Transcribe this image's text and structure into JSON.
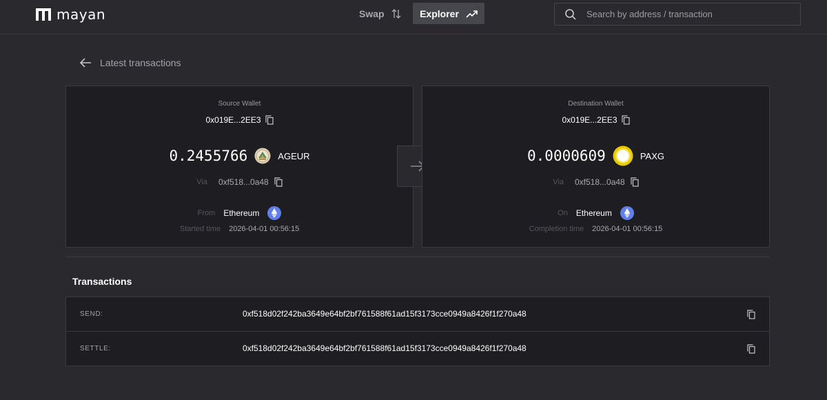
{
  "header": {
    "logo_text": "mayan",
    "nav": {
      "swap_label": "Swap",
      "explorer_label": "Explorer"
    },
    "search": {
      "placeholder": "Search by address / transaction",
      "value": ""
    }
  },
  "back_link": {
    "label": "Latest transactions"
  },
  "source": {
    "title": "Source Wallet",
    "wallet": "0x019E...2EE3",
    "amount": "0.2455766",
    "token": "AGEUR",
    "via_label": "Via",
    "via_value": "0xf518...0a48",
    "chain_label": "From",
    "chain": "Ethereum",
    "time_label": "Started time",
    "time": "2026-04-01 00:56:15"
  },
  "destination": {
    "title": "Destination Wallet",
    "wallet": "0x019E...2EE3",
    "amount": "0.0000609",
    "token": "PAXG",
    "via_label": "Via",
    "via_value": "0xf518...0a48",
    "chain_label": "On",
    "chain": "Ethereum",
    "time_label": "Completion time",
    "time": "2026-04-01 00:56:15"
  },
  "transactions": {
    "heading": "Transactions",
    "rows": [
      {
        "label": "SEND:",
        "hash": "0xf518d02f242ba3649e64bf2bf761588f61ad15f3173cce0949a8426f1f270a48"
      },
      {
        "label": "SETTLE:",
        "hash": "0xf518d02f242ba3649e64bf2bf761588f61ad15f3173cce0949a8426f1f270a48"
      }
    ]
  },
  "icons": {
    "logo": "mayan-logo-icon",
    "swap": "swap-arrows-icon",
    "explorer": "trend-line-icon",
    "search": "search-icon",
    "back": "arrow-left-icon",
    "copy": "copy-icon",
    "ageur": "ageur-token-icon",
    "paxg": "paxg-token-icon",
    "ethereum": "ethereum-icon",
    "transfer": "arrow-right-icon"
  },
  "colors": {
    "background": "#29292e",
    "card": "#1e1e22",
    "border": "#3a3a40",
    "ethereum": "#627eea",
    "paxg": "#e8c900"
  }
}
